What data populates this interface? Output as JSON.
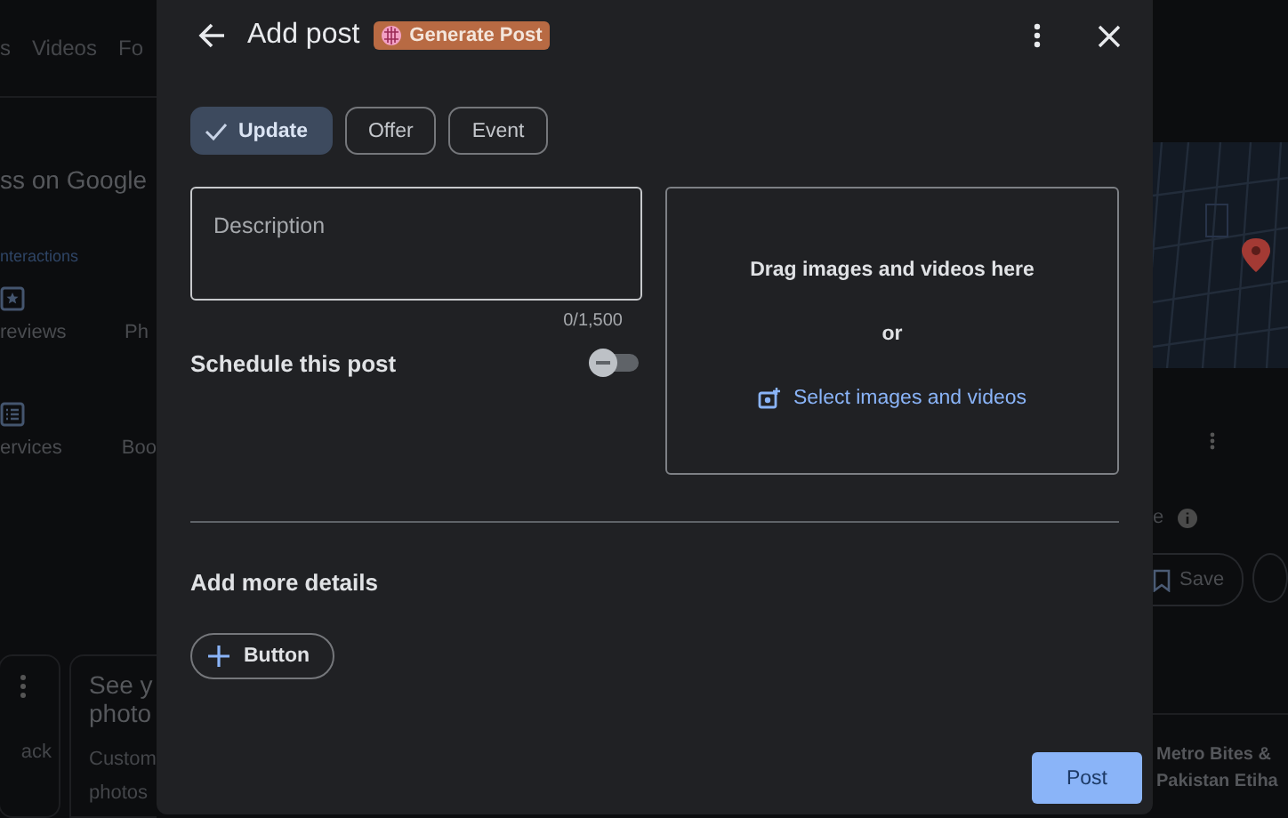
{
  "background": {
    "tabs": [
      "s",
      "Videos",
      "Fo"
    ],
    "heading": "ss on Google",
    "link": "nteractions",
    "actions": [
      {
        "kind": "star",
        "label": "reviews",
        "next": "Ph"
      },
      {
        "kind": "list",
        "label": "ervices",
        "next": "Boo"
      }
    ],
    "cards": [
      {
        "lines": [
          "ack"
        ],
        "menu": true
      },
      {
        "title": [
          "See y",
          "photo"
        ],
        "lines": [
          "Custom",
          "photos"
        ],
        "menu": false
      }
    ],
    "side": {
      "label": "e",
      "save": "Save",
      "lines": [
        "Metro Bites &",
        "Pakistan Etiha"
      ]
    }
  },
  "dialog": {
    "title": "Add post",
    "badge": "Generate Post",
    "tabs": [
      {
        "label": "Update",
        "selected": true
      },
      {
        "label": "Offer",
        "selected": false
      },
      {
        "label": "Event",
        "selected": false
      }
    ],
    "description": {
      "placeholder": "Description",
      "counter": "0/1,500"
    },
    "schedule": {
      "label": "Schedule this post",
      "on": false
    },
    "media": {
      "drag": "Drag images and videos here",
      "or": "or",
      "select": "Select images and videos"
    },
    "more": {
      "heading": "Add more details",
      "button": "Button"
    },
    "post": "Post"
  }
}
